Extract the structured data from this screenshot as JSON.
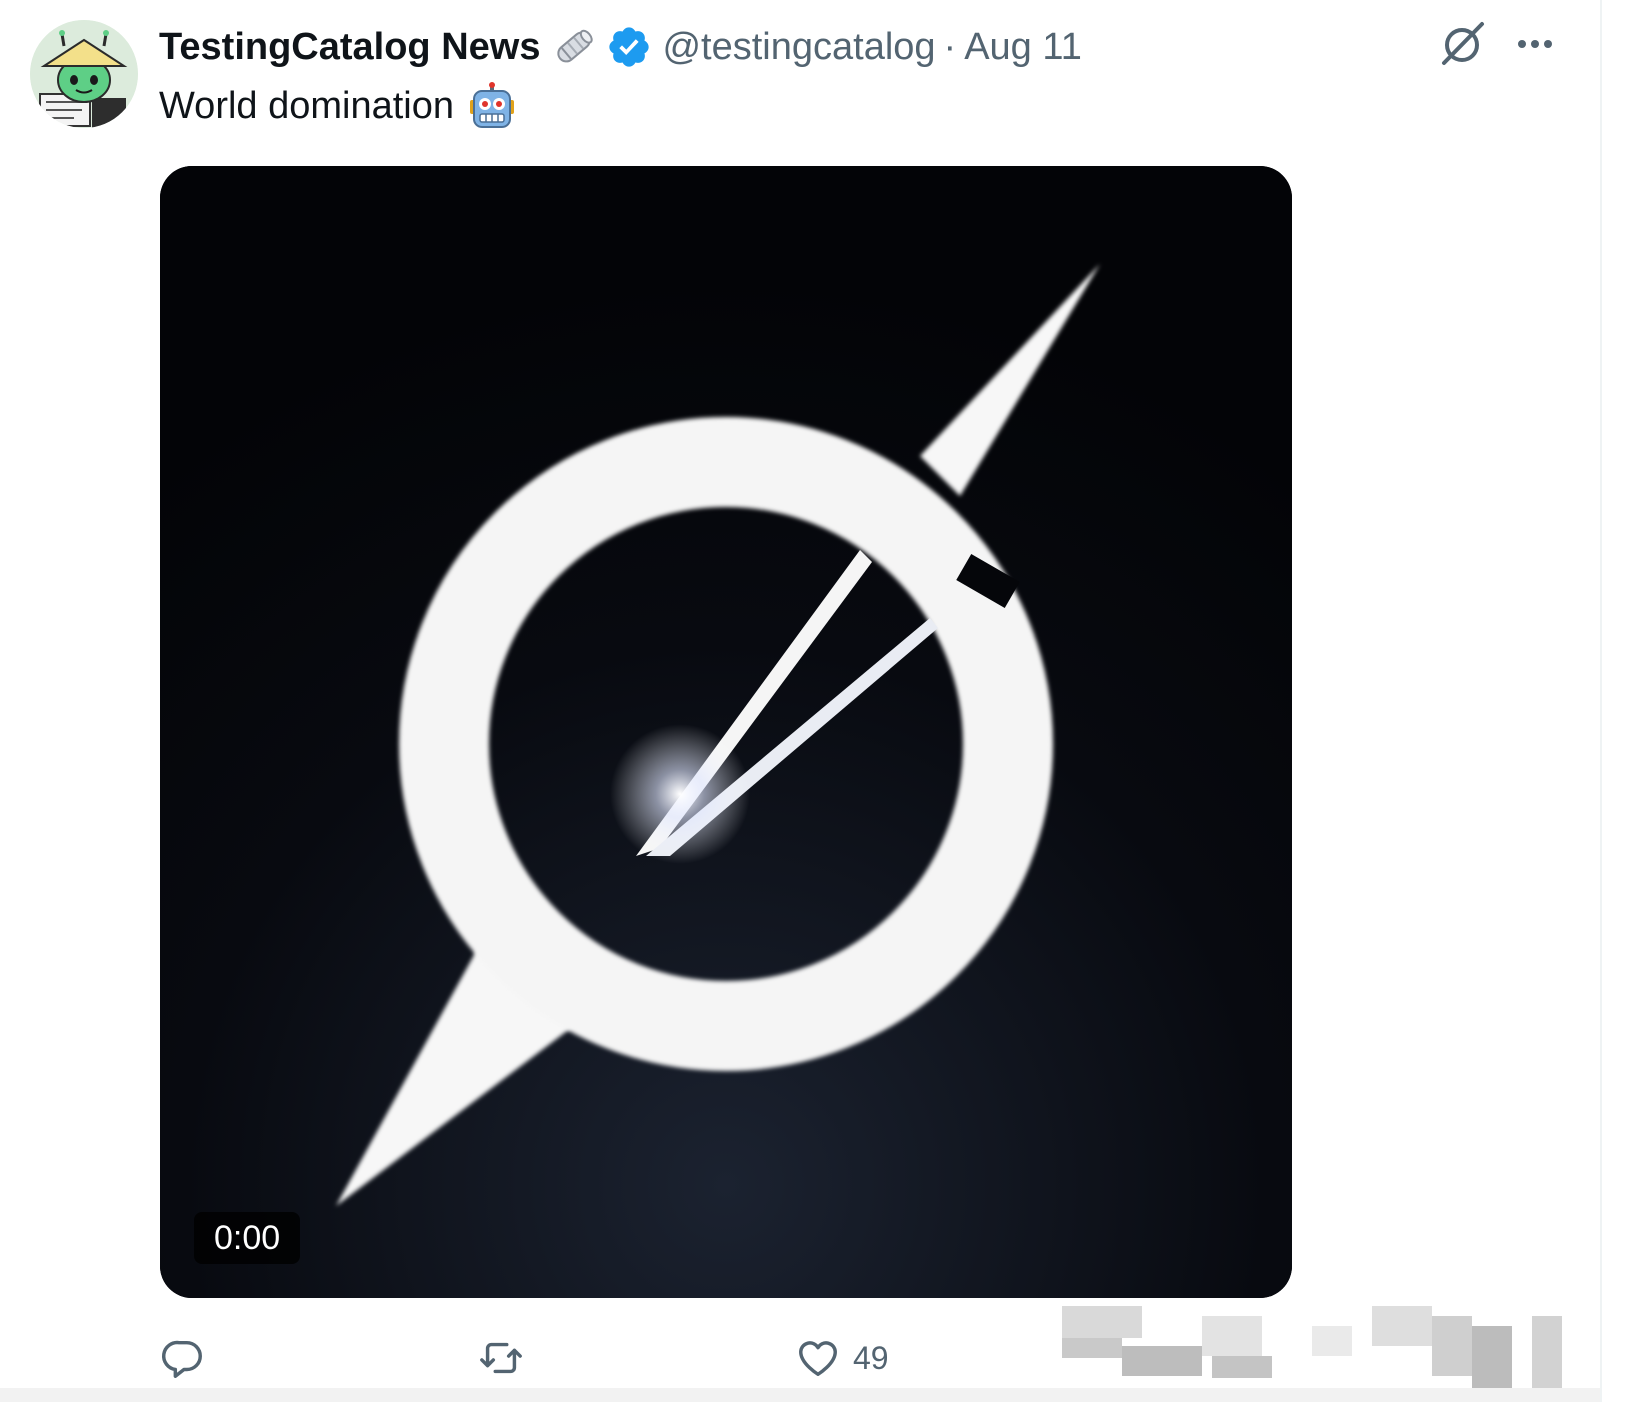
{
  "tweet": {
    "author": {
      "display_name": "TestingCatalog News",
      "handle": "@testingcatalog",
      "verified": true,
      "avatar": "cartoon-character-reading-newspaper"
    },
    "separator": "·",
    "date": "Aug 11",
    "text": "World domination",
    "text_emoji": "robot-face",
    "name_emoji": "rolled-newspaper",
    "media": {
      "type": "video",
      "duration": "0:00",
      "thumbnail": "white-ring-logo-on-black"
    },
    "actions": {
      "reply_icon": "reply-icon",
      "repost_icon": "repost-icon",
      "like_icon": "heart-icon",
      "like_count": "49"
    },
    "top_right": {
      "grok_icon": "grok-icon",
      "more_icon": "more-icon"
    }
  },
  "colors": {
    "text_primary": "#0f1419",
    "text_secondary": "#536471",
    "verified_blue": "#1d9bf0",
    "media_background": "#05060a"
  }
}
